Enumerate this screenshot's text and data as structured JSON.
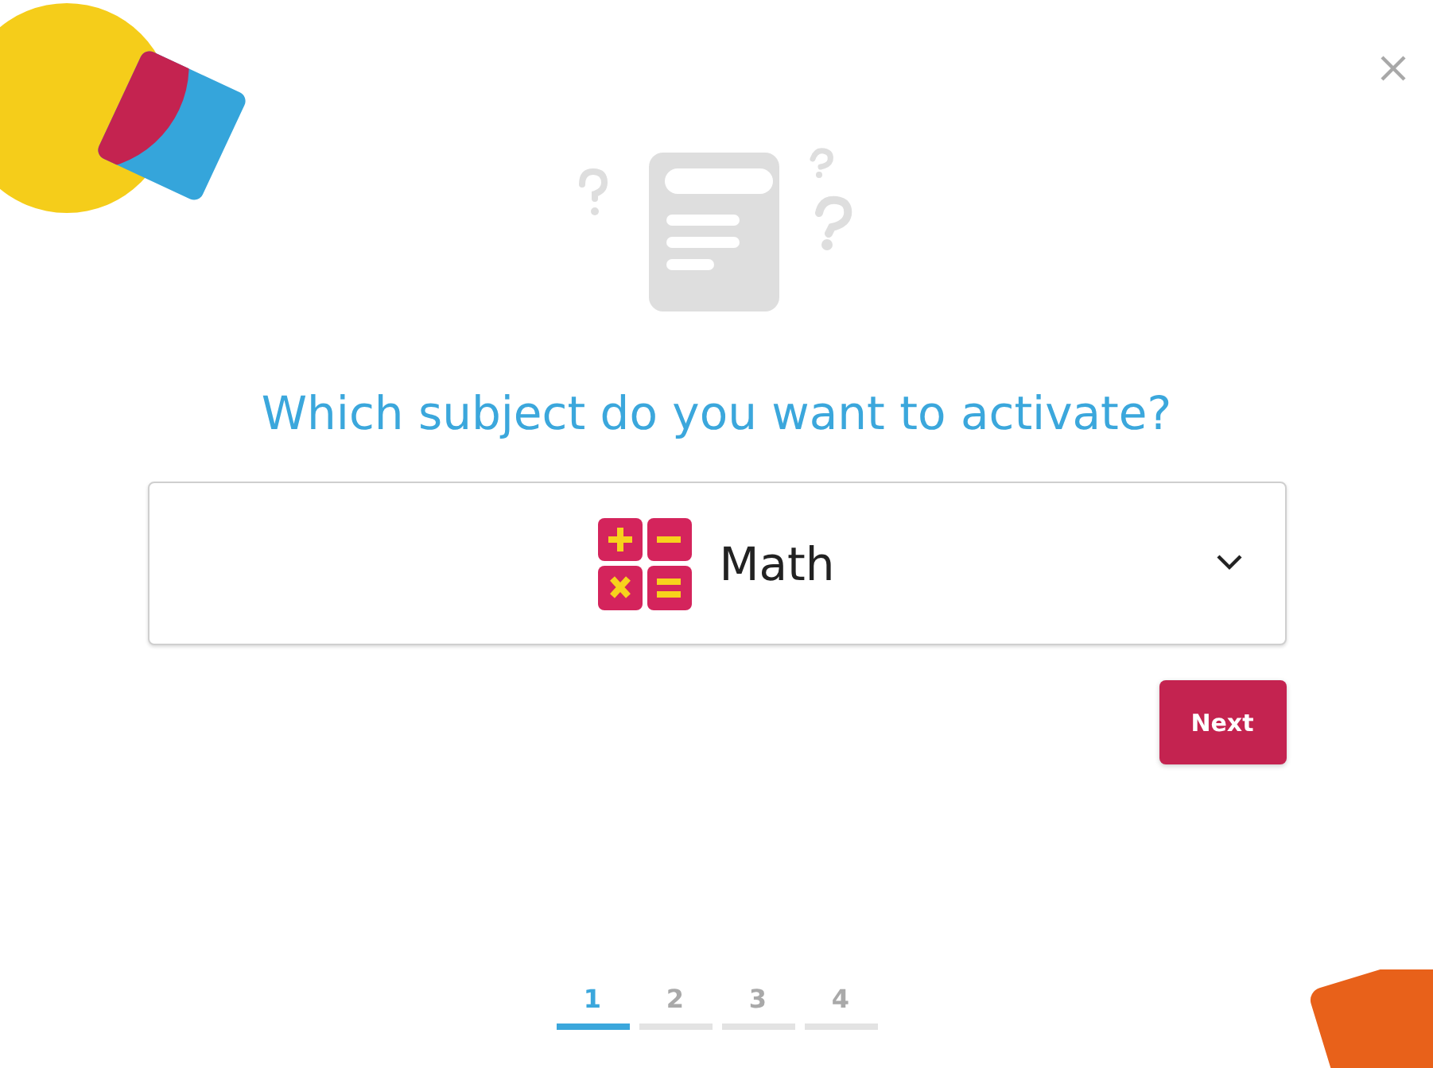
{
  "title": "Which subject do you want to activate?",
  "subject_select": {
    "value": "Math"
  },
  "next_button": "Next",
  "steps": [
    {
      "label": "1",
      "selected": true
    },
    {
      "label": "2",
      "selected": false
    },
    {
      "label": "3",
      "selected": false
    },
    {
      "label": "4",
      "selected": false
    }
  ]
}
